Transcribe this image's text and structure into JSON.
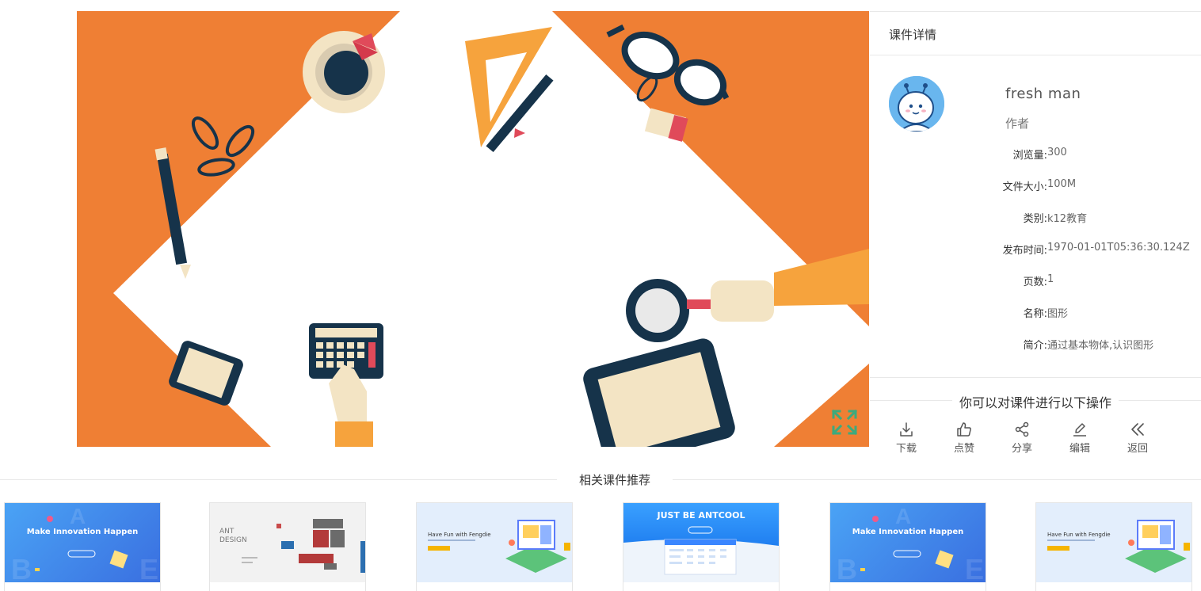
{
  "panel": {
    "title": "课件详情",
    "author_name": "fresh man",
    "author_role": "作者",
    "info": [
      {
        "label": "浏览量:",
        "value": "300"
      },
      {
        "label": "文件大小:",
        "value": "100M"
      },
      {
        "label": "类别:",
        "value": "k12教育"
      },
      {
        "label": "发布时间:",
        "value": "1970-01-01T05:36:30.124Z"
      },
      {
        "label": "页数:",
        "value": "1"
      },
      {
        "label": "名称:",
        "value": "图形"
      },
      {
        "label": "简介:",
        "value": "通过基本物体,认识图形"
      }
    ],
    "ops_title": "你可以对课件进行以下操作",
    "ops": [
      {
        "label": "下载",
        "icon": "download-icon"
      },
      {
        "label": "点赞",
        "icon": "like-icon"
      },
      {
        "label": "分享",
        "icon": "share-icon"
      },
      {
        "label": "编辑",
        "icon": "edit-icon"
      },
      {
        "label": "返回",
        "icon": "back-icon"
      }
    ]
  },
  "related": {
    "title": "相关课件推荐",
    "cards": [
      {
        "thumb_title": "Make Innovation Happen",
        "style": "innovation"
      },
      {
        "thumb_title": "ANT DESIGN",
        "style": "antdesign"
      },
      {
        "thumb_title": "Have Fun with Fengdie",
        "style": "fengdie"
      },
      {
        "thumb_title": "JUST BE ANTCOOL",
        "style": "antcool"
      },
      {
        "thumb_title": "Make Innovation Happen",
        "style": "innovation"
      },
      {
        "thumb_title": "Have Fun with Fengdie",
        "style": "fengdie"
      }
    ]
  },
  "colors": {
    "preview_bg": "#ef7f34",
    "fullscreen_icon": "#3daa7d",
    "avatar_bg": "#69b6ee"
  }
}
